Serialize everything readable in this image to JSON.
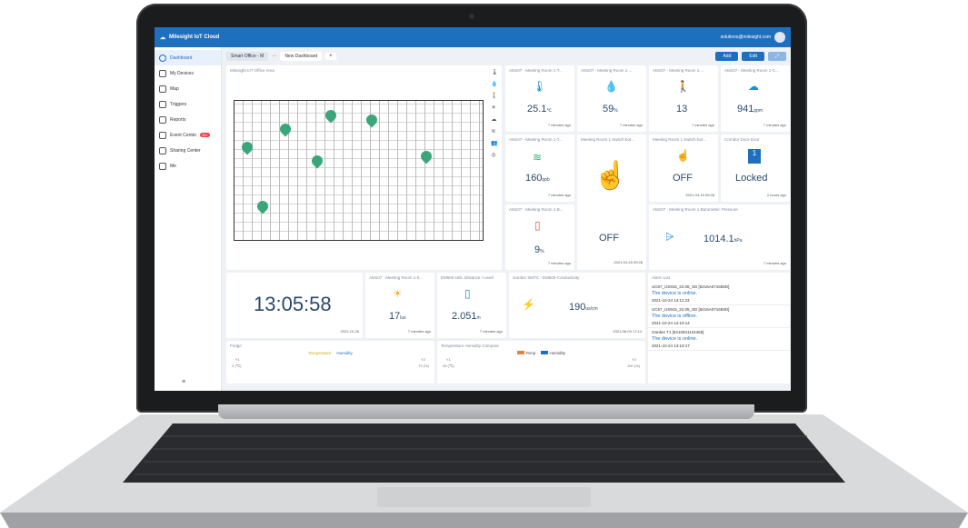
{
  "app": {
    "title": "Milesight IoT Cloud",
    "user_email": "solutions@milesight.com"
  },
  "sidebar": {
    "items": [
      {
        "label": "Dashboard",
        "active": true
      },
      {
        "label": "My Devices"
      },
      {
        "label": "Map"
      },
      {
        "label": "Triggers"
      },
      {
        "label": "Reports"
      },
      {
        "label": "Event Center",
        "badge": "99+"
      },
      {
        "label": "Sharing Center"
      },
      {
        "label": "Me"
      }
    ]
  },
  "tabs": {
    "items": [
      "Smart Office - M",
      "New Dashboard"
    ],
    "more": "···",
    "add": "+"
  },
  "toolbar": {
    "add": "Add",
    "edit": "Edit"
  },
  "widgets": {
    "floorplan": {
      "title": "Milesight IoT Office Area"
    },
    "temp": {
      "title": "AM107 - Meeting Room 1-T...",
      "value": "25.1",
      "unit": "℃",
      "time": "7 minutes ago"
    },
    "humidity": {
      "title": "AM107 - Meeting Room 1-...",
      "value": "59",
      "unit": "%",
      "time": "7 minutes ago"
    },
    "activity": {
      "title": "AM107 - Meeting Room 1-...",
      "value": "13",
      "time": "7 minutes ago"
    },
    "co2": {
      "title": "AM107 - Meeting Room 1-C...",
      "value": "941",
      "unit": "ppm",
      "time": "7 minutes ago"
    },
    "tvoc": {
      "title": "AM107 - Meeting Room 1-T...",
      "value": "160",
      "unit": "ppb",
      "time": "7 minutes ago"
    },
    "switch1": {
      "title": "Meeting Room 1 Switch-bot...",
      "value": "OFF",
      "time": "2021-04-15 09:28"
    },
    "switch2": {
      "title": "Meeting Room 1 Switch-bot...",
      "value": "OFF",
      "time": "2021-04-15 09:28"
    },
    "door": {
      "title": "Corridor Door-Door",
      "value": "Locked",
      "time": "2 hours ago"
    },
    "battery": {
      "title": "AM107 - Meeting Room 1-B...",
      "value": "9",
      "unit": "%",
      "time": "7 minutes ago"
    },
    "pressure": {
      "title": "AM107 - Meeting Room 1-Barometric Pressure",
      "value": "1014.1",
      "unit": "hPa",
      "time": "7 minutes ago"
    },
    "clock": {
      "value": "13:05:58",
      "date": "2021-10-26"
    },
    "light": {
      "title": "AM107 - Meeting Room 1-Il...",
      "value": "17",
      "unit": "lux",
      "time": "7 minutes ago"
    },
    "distance": {
      "title": "EM500-UDL Distance / Level",
      "value": "2.051",
      "unit": "m",
      "time": "7 minutes ago"
    },
    "conductivity": {
      "title": "Garden SMTC - EM500-Conductivity",
      "value": "190",
      "unit": "us/cm",
      "time": "2021-06-09 17:14"
    },
    "alarms": {
      "title": "Alarm List",
      "items": [
        {
          "device": "UC67_US915_22.05_SD [6216A071658D]",
          "msg": "The device is online.",
          "time": "2021-10-24 14:11:23"
        },
        {
          "device": "UC67_US915_22.05_SD [6216A071658D]",
          "msg": "The device is offline.",
          "time": "2021-10-24 14:10:14"
        },
        {
          "device": "Garden T1 [6410941122465]",
          "msg": "The device is online.",
          "time": "2021-10-24 14:10:17"
        }
      ]
    },
    "fridge": {
      "title": "Fridge",
      "legend": [
        "Temperature",
        "Humidity"
      ],
      "y1": "Y1",
      "y2": "Y2",
      "y1_unit": "0 (℃)",
      "y2_unit": "70 (%)"
    },
    "compare": {
      "title": "Temperature Humidity Compare",
      "legend": [
        "Temp",
        "Humidity"
      ],
      "y1": "Y1",
      "y2": "Y2",
      "y1_unit": "35 (℃)",
      "y2_unit": "100 (%)"
    }
  }
}
